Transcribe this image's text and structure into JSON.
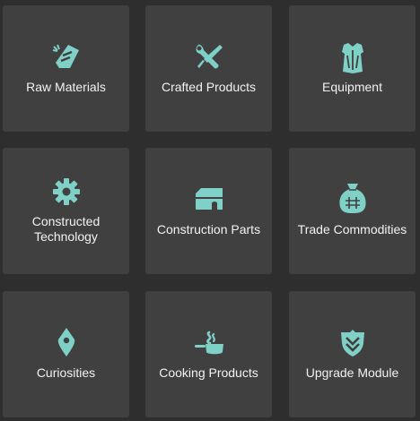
{
  "colors": {
    "background": "#2e2e2e",
    "tile": "#404040",
    "icon": "#7fd0c6",
    "text": "#f2f2f2"
  },
  "categories": [
    {
      "label": "Raw Materials",
      "icon": "pickaxe-icon"
    },
    {
      "label": "Crafted Products",
      "icon": "wrench-screwdriver-icon"
    },
    {
      "label": "Equipment",
      "icon": "armor-icon"
    },
    {
      "label": "Constructed Technology",
      "icon": "gear-icon"
    },
    {
      "label": "Construction Parts",
      "icon": "building-icon"
    },
    {
      "label": "Trade Commodities",
      "icon": "sack-icon"
    },
    {
      "label": "Curiosities",
      "icon": "location-pin-icon"
    },
    {
      "label": "Cooking Products",
      "icon": "cooking-pan-icon"
    },
    {
      "label": "Upgrade Module",
      "icon": "chevron-shield-icon"
    }
  ]
}
